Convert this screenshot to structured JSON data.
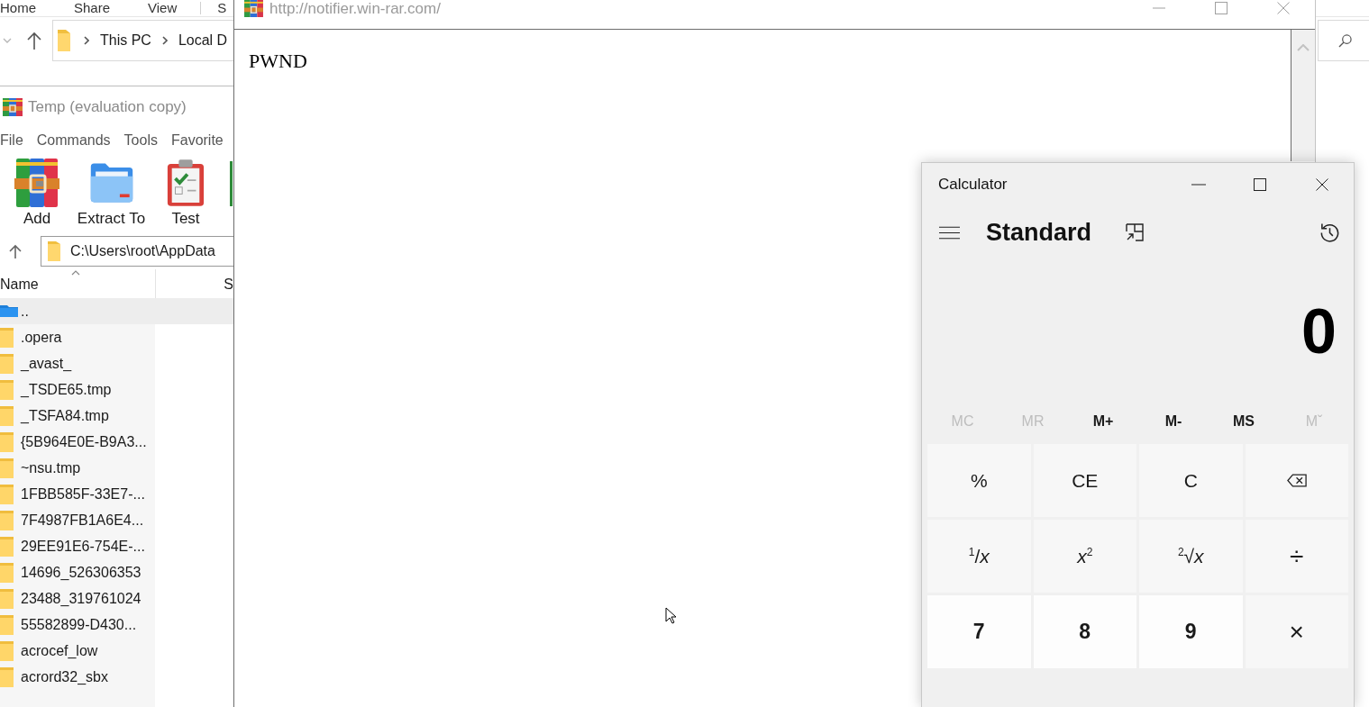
{
  "explorer": {
    "ribbon_tabs": [
      {
        "label": "Home",
        "kind": "tab"
      },
      {
        "label": "Share",
        "kind": "tab"
      },
      {
        "label": "View",
        "kind": "tab"
      },
      {
        "label": "S",
        "kind": "contextual"
      }
    ],
    "breadcrumbs": [
      "This PC",
      "Local D"
    ]
  },
  "archiver": {
    "title": "Temp (evaluation copy)",
    "menu": [
      "File",
      "Commands",
      "Tools",
      "Favorite"
    ],
    "toolbar": [
      {
        "kind": "add",
        "label": "Add"
      },
      {
        "kind": "extract",
        "label": "Extract To"
      },
      {
        "kind": "test",
        "label": "Test"
      },
      {
        "kind": "partial"
      }
    ],
    "path": "C:\\Users\\root\\AppData",
    "columns": [
      {
        "label": "Name",
        "sorted": true
      },
      {
        "label": "S",
        "sorted": false
      }
    ],
    "files": [
      {
        "name": "..",
        "kind": "parent",
        "selected": true
      },
      {
        "name": ".opera",
        "kind": "folder",
        "selected": false
      },
      {
        "name": "_avast_",
        "kind": "folder",
        "selected": false
      },
      {
        "name": "_TSDE65.tmp",
        "kind": "folder",
        "selected": false
      },
      {
        "name": "_TSFA84.tmp",
        "kind": "folder",
        "selected": false
      },
      {
        "name": "{5B964E0E-B9A3...",
        "kind": "folder",
        "selected": false
      },
      {
        "name": "~nsu.tmp",
        "kind": "folder",
        "selected": false
      },
      {
        "name": "1FBB585F-33E7-...",
        "kind": "folder",
        "selected": false
      },
      {
        "name": "7F4987FB1A6E4...",
        "kind": "folder",
        "selected": false
      },
      {
        "name": "29EE91E6-754E-...",
        "kind": "folder",
        "selected": false
      },
      {
        "name": "14696_526306353",
        "kind": "folder",
        "selected": false
      },
      {
        "name": "23488_319761024",
        "kind": "folder",
        "selected": false
      },
      {
        "name": "55582899-D430...",
        "kind": "folder",
        "selected": false
      },
      {
        "name": "acrocef_low",
        "kind": "folder",
        "selected": false
      },
      {
        "name": "acrord32_sbx",
        "kind": "folder",
        "selected": false
      }
    ]
  },
  "browser": {
    "title": "http://notifier.win-rar.com/",
    "content": "PWND"
  },
  "calculator": {
    "title": "Calculator",
    "mode": "Standard",
    "display": "0",
    "memory": [
      {
        "label": "MC",
        "disabled": true
      },
      {
        "label": "MR",
        "disabled": true
      },
      {
        "label": "M+",
        "disabled": false
      },
      {
        "label": "M-",
        "disabled": false
      },
      {
        "label": "MS",
        "disabled": false
      },
      {
        "label": "Mˇ",
        "disabled": true
      }
    ],
    "keys": [
      {
        "label": "%",
        "kind": "function"
      },
      {
        "label": "CE",
        "kind": "function"
      },
      {
        "label": "C",
        "kind": "function"
      },
      {
        "kind": "backspace"
      },
      {
        "label": "$^{1}$/*x*",
        "kind": "function"
      },
      {
        "label": "*x*$^{2}$",
        "kind": "function"
      },
      {
        "label": "$^{2}$√*x*",
        "kind": "function"
      },
      {
        "label": "÷",
        "kind": "operator"
      },
      {
        "label": "7",
        "kind": "digit"
      },
      {
        "label": "8",
        "kind": "digit"
      },
      {
        "label": "9",
        "kind": "digit"
      },
      {
        "label": "×",
        "kind": "operator"
      }
    ]
  }
}
